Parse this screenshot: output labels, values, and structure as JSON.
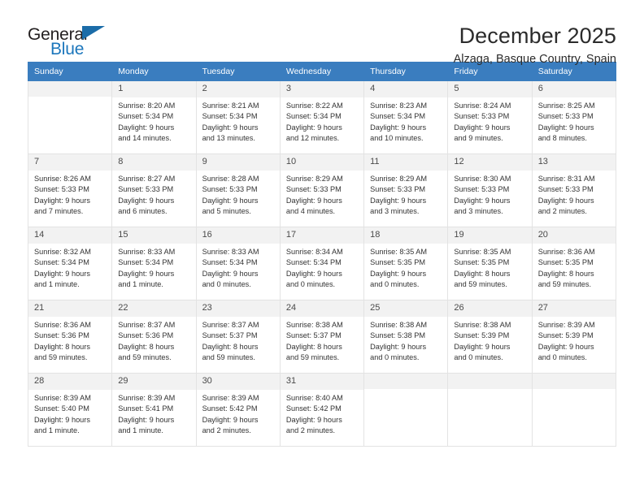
{
  "brand": {
    "name_part1": "General",
    "name_part2": "Blue",
    "accent_color": "#1b76bc",
    "triangle_color": "#1b6ca8"
  },
  "header": {
    "month_title": "December 2025",
    "location": "Alzaga, Basque Country, Spain"
  },
  "calendar": {
    "header_bg": "#3a7dbf",
    "weekdays": [
      "Sunday",
      "Monday",
      "Tuesday",
      "Wednesday",
      "Thursday",
      "Friday",
      "Saturday"
    ],
    "weeks": [
      [
        {
          "day": "",
          "empty": true,
          "sunrise": "",
          "sunset": "",
          "daylight1": "",
          "daylight2": ""
        },
        {
          "day": "1",
          "sunrise": "Sunrise: 8:20 AM",
          "sunset": "Sunset: 5:34 PM",
          "daylight1": "Daylight: 9 hours",
          "daylight2": "and 14 minutes."
        },
        {
          "day": "2",
          "sunrise": "Sunrise: 8:21 AM",
          "sunset": "Sunset: 5:34 PM",
          "daylight1": "Daylight: 9 hours",
          "daylight2": "and 13 minutes."
        },
        {
          "day": "3",
          "sunrise": "Sunrise: 8:22 AM",
          "sunset": "Sunset: 5:34 PM",
          "daylight1": "Daylight: 9 hours",
          "daylight2": "and 12 minutes."
        },
        {
          "day": "4",
          "sunrise": "Sunrise: 8:23 AM",
          "sunset": "Sunset: 5:34 PM",
          "daylight1": "Daylight: 9 hours",
          "daylight2": "and 10 minutes."
        },
        {
          "day": "5",
          "sunrise": "Sunrise: 8:24 AM",
          "sunset": "Sunset: 5:33 PM",
          "daylight1": "Daylight: 9 hours",
          "daylight2": "and 9 minutes."
        },
        {
          "day": "6",
          "sunrise": "Sunrise: 8:25 AM",
          "sunset": "Sunset: 5:33 PM",
          "daylight1": "Daylight: 9 hours",
          "daylight2": "and 8 minutes."
        }
      ],
      [
        {
          "day": "7",
          "sunrise": "Sunrise: 8:26 AM",
          "sunset": "Sunset: 5:33 PM",
          "daylight1": "Daylight: 9 hours",
          "daylight2": "and 7 minutes."
        },
        {
          "day": "8",
          "sunrise": "Sunrise: 8:27 AM",
          "sunset": "Sunset: 5:33 PM",
          "daylight1": "Daylight: 9 hours",
          "daylight2": "and 6 minutes."
        },
        {
          "day": "9",
          "sunrise": "Sunrise: 8:28 AM",
          "sunset": "Sunset: 5:33 PM",
          "daylight1": "Daylight: 9 hours",
          "daylight2": "and 5 minutes."
        },
        {
          "day": "10",
          "sunrise": "Sunrise: 8:29 AM",
          "sunset": "Sunset: 5:33 PM",
          "daylight1": "Daylight: 9 hours",
          "daylight2": "and 4 minutes."
        },
        {
          "day": "11",
          "sunrise": "Sunrise: 8:29 AM",
          "sunset": "Sunset: 5:33 PM",
          "daylight1": "Daylight: 9 hours",
          "daylight2": "and 3 minutes."
        },
        {
          "day": "12",
          "sunrise": "Sunrise: 8:30 AM",
          "sunset": "Sunset: 5:33 PM",
          "daylight1": "Daylight: 9 hours",
          "daylight2": "and 3 minutes."
        },
        {
          "day": "13",
          "sunrise": "Sunrise: 8:31 AM",
          "sunset": "Sunset: 5:33 PM",
          "daylight1": "Daylight: 9 hours",
          "daylight2": "and 2 minutes."
        }
      ],
      [
        {
          "day": "14",
          "sunrise": "Sunrise: 8:32 AM",
          "sunset": "Sunset: 5:34 PM",
          "daylight1": "Daylight: 9 hours",
          "daylight2": "and 1 minute."
        },
        {
          "day": "15",
          "sunrise": "Sunrise: 8:33 AM",
          "sunset": "Sunset: 5:34 PM",
          "daylight1": "Daylight: 9 hours",
          "daylight2": "and 1 minute."
        },
        {
          "day": "16",
          "sunrise": "Sunrise: 8:33 AM",
          "sunset": "Sunset: 5:34 PM",
          "daylight1": "Daylight: 9 hours",
          "daylight2": "and 0 minutes."
        },
        {
          "day": "17",
          "sunrise": "Sunrise: 8:34 AM",
          "sunset": "Sunset: 5:34 PM",
          "daylight1": "Daylight: 9 hours",
          "daylight2": "and 0 minutes."
        },
        {
          "day": "18",
          "sunrise": "Sunrise: 8:35 AM",
          "sunset": "Sunset: 5:35 PM",
          "daylight1": "Daylight: 9 hours",
          "daylight2": "and 0 minutes."
        },
        {
          "day": "19",
          "sunrise": "Sunrise: 8:35 AM",
          "sunset": "Sunset: 5:35 PM",
          "daylight1": "Daylight: 8 hours",
          "daylight2": "and 59 minutes."
        },
        {
          "day": "20",
          "sunrise": "Sunrise: 8:36 AM",
          "sunset": "Sunset: 5:35 PM",
          "daylight1": "Daylight: 8 hours",
          "daylight2": "and 59 minutes."
        }
      ],
      [
        {
          "day": "21",
          "sunrise": "Sunrise: 8:36 AM",
          "sunset": "Sunset: 5:36 PM",
          "daylight1": "Daylight: 8 hours",
          "daylight2": "and 59 minutes."
        },
        {
          "day": "22",
          "sunrise": "Sunrise: 8:37 AM",
          "sunset": "Sunset: 5:36 PM",
          "daylight1": "Daylight: 8 hours",
          "daylight2": "and 59 minutes."
        },
        {
          "day": "23",
          "sunrise": "Sunrise: 8:37 AM",
          "sunset": "Sunset: 5:37 PM",
          "daylight1": "Daylight: 8 hours",
          "daylight2": "and 59 minutes."
        },
        {
          "day": "24",
          "sunrise": "Sunrise: 8:38 AM",
          "sunset": "Sunset: 5:37 PM",
          "daylight1": "Daylight: 8 hours",
          "daylight2": "and 59 minutes."
        },
        {
          "day": "25",
          "sunrise": "Sunrise: 8:38 AM",
          "sunset": "Sunset: 5:38 PM",
          "daylight1": "Daylight: 9 hours",
          "daylight2": "and 0 minutes."
        },
        {
          "day": "26",
          "sunrise": "Sunrise: 8:38 AM",
          "sunset": "Sunset: 5:39 PM",
          "daylight1": "Daylight: 9 hours",
          "daylight2": "and 0 minutes."
        },
        {
          "day": "27",
          "sunrise": "Sunrise: 8:39 AM",
          "sunset": "Sunset: 5:39 PM",
          "daylight1": "Daylight: 9 hours",
          "daylight2": "and 0 minutes."
        }
      ],
      [
        {
          "day": "28",
          "sunrise": "Sunrise: 8:39 AM",
          "sunset": "Sunset: 5:40 PM",
          "daylight1": "Daylight: 9 hours",
          "daylight2": "and 1 minute."
        },
        {
          "day": "29",
          "sunrise": "Sunrise: 8:39 AM",
          "sunset": "Sunset: 5:41 PM",
          "daylight1": "Daylight: 9 hours",
          "daylight2": "and 1 minute."
        },
        {
          "day": "30",
          "sunrise": "Sunrise: 8:39 AM",
          "sunset": "Sunset: 5:42 PM",
          "daylight1": "Daylight: 9 hours",
          "daylight2": "and 2 minutes."
        },
        {
          "day": "31",
          "sunrise": "Sunrise: 8:40 AM",
          "sunset": "Sunset: 5:42 PM",
          "daylight1": "Daylight: 9 hours",
          "daylight2": "and 2 minutes."
        },
        {
          "day": "",
          "empty": true,
          "sunrise": "",
          "sunset": "",
          "daylight1": "",
          "daylight2": ""
        },
        {
          "day": "",
          "empty": true,
          "sunrise": "",
          "sunset": "",
          "daylight1": "",
          "daylight2": ""
        },
        {
          "day": "",
          "empty": true,
          "sunrise": "",
          "sunset": "",
          "daylight1": "",
          "daylight2": ""
        }
      ]
    ]
  }
}
